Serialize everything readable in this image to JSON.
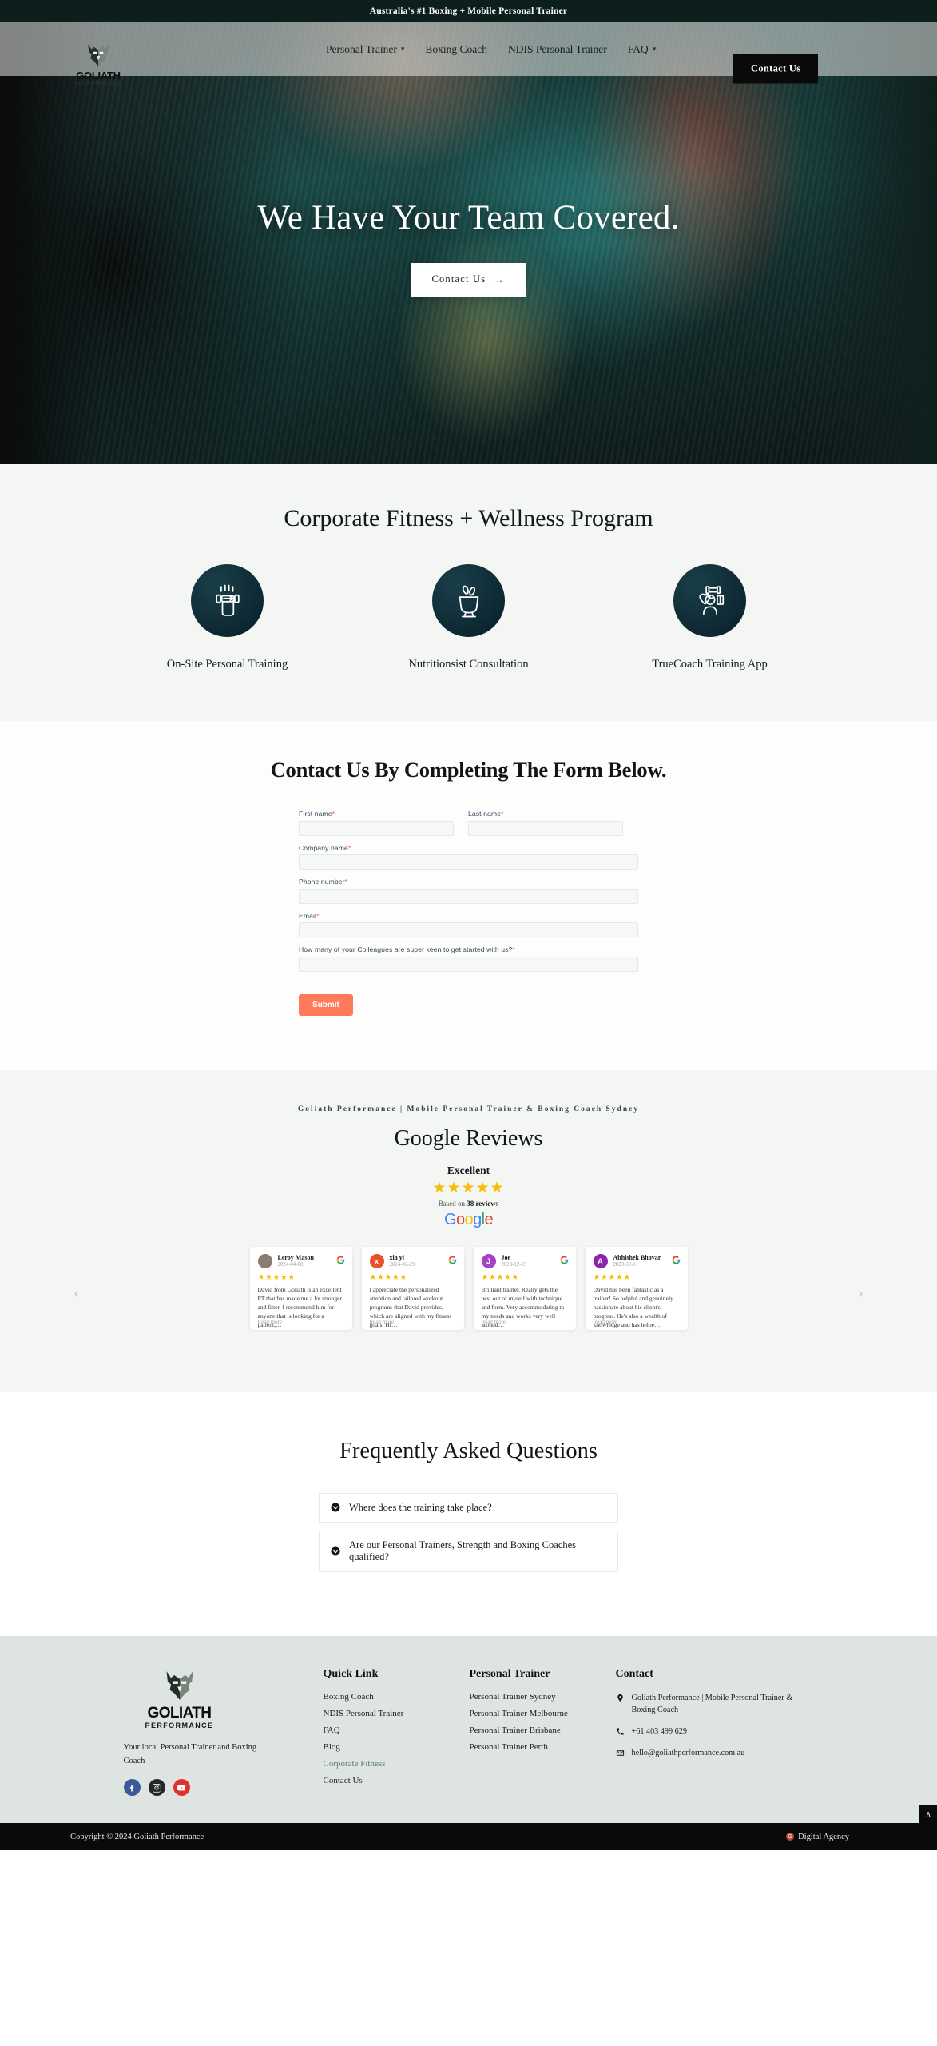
{
  "announcement": {
    "text": "Australia's #1 Boxing + Mobile Personal Trainer"
  },
  "brand": {
    "name": "GOLIATH",
    "sub": "PERFORMANCE"
  },
  "nav": {
    "items": [
      {
        "label": "Personal Trainer",
        "has_caret": true
      },
      {
        "label": "Boxing Coach",
        "has_caret": false
      },
      {
        "label": "NDIS Personal Trainer",
        "has_caret": false
      },
      {
        "label": "FAQ",
        "has_caret": true
      }
    ],
    "cta": "Contact Us"
  },
  "hero": {
    "title": "We Have Your Team Covered.",
    "cta": "Contact Us",
    "cta_arrow": "→"
  },
  "program": {
    "title": "Corporate Fitness + Wellness Program",
    "cards": [
      {
        "label": "On-Site Personal Training",
        "icon": "dumbbell-hand-icon"
      },
      {
        "label": "Nutritionsist Consultation",
        "icon": "nutrition-bowl-icon"
      },
      {
        "label": "TrueCoach Training App",
        "icon": "coach-app-icon"
      }
    ]
  },
  "form": {
    "title": "Contact Us By Completing The Form Below.",
    "fields": [
      {
        "label": "First name",
        "required": true,
        "value": "",
        "placeholder": "",
        "width": "half"
      },
      {
        "label": "Last name",
        "required": true,
        "value": "",
        "placeholder": "",
        "width": "half"
      },
      {
        "label": "Company name",
        "required": true,
        "value": "",
        "placeholder": "",
        "width": "full"
      },
      {
        "label": "Phone number",
        "required": true,
        "value": "",
        "placeholder": "",
        "width": "full"
      },
      {
        "label": "Email",
        "required": true,
        "value": "",
        "placeholder": "",
        "width": "full"
      },
      {
        "label": "How many of your Colleagues are super keen to get started with us?",
        "required": true,
        "value": "",
        "placeholder": "",
        "width": "full"
      }
    ],
    "submit": "Submit"
  },
  "reviews": {
    "eyebrow": "Goliath Performance | Mobile Personal Trainer & Boxing Coach Sydney",
    "title": "Google Reviews",
    "rating_word": "Excellent",
    "stars": "★★★★★",
    "based_prefix": "Based on ",
    "based_count": "38 reviews",
    "google_letters": [
      "G",
      "o",
      "o",
      "g",
      "l",
      "e"
    ],
    "read_more": "Read more",
    "items": [
      {
        "name": "Leroy Mason",
        "date": "2024-04-08",
        "initial": "L",
        "avatar_color": "#8a7c6e",
        "avatar_photo": true,
        "stars": "★★★★★",
        "text": "David from Goliath is an excellent PT that has made me a lot stronger and fitter. I recommend him for anyone that is looking for a patient,…"
      },
      {
        "name": "xia yi",
        "date": "2024-02-29",
        "initial": "x",
        "avatar_color": "#e8512a",
        "avatar_photo": false,
        "stars": "★★★★★",
        "text": "I appreciate the personalized attention and tailored workout programs that David provides, which are aligned with my fitness goals. Hi…"
      },
      {
        "name": "Joe",
        "date": "2023-12-15",
        "initial": "J",
        "avatar_color": "#a342c4",
        "avatar_photo": false,
        "stars": "★★★★★",
        "text": "Brilliant trainer. Really gets the best out of myself with technique and form. Very accommodating to my needs and works very well around…"
      },
      {
        "name": "Abhishek Bhovar",
        "date": "2023-12-11",
        "initial": "A",
        "avatar_color": "#8e24aa",
        "avatar_photo": false,
        "stars": "★★★★★",
        "text": "David has been fantastic as a trainer! So helpful and genuinely passionate about his client's progress. He's also a wealth of knowledge and has helpe…"
      }
    ],
    "prev_arrow": "‹",
    "next_arrow": "›"
  },
  "faq": {
    "title": "Frequently Asked Questions",
    "items": [
      {
        "question": "Where does the training take place?"
      },
      {
        "question": "Are our Personal Trainers, Strength and Boxing Coaches qualified?"
      }
    ]
  },
  "footer": {
    "tagline": "Your local Personal Trainer and Boxing Coach",
    "socials": [
      {
        "name": "facebook-icon"
      },
      {
        "name": "instagram-icon"
      },
      {
        "name": "youtube-icon"
      }
    ],
    "quick_link": {
      "heading": "Quick Link",
      "items": [
        {
          "label": "Boxing Coach",
          "active": false
        },
        {
          "label": "NDIS Personal Trainer",
          "active": false
        },
        {
          "label": "FAQ",
          "active": false
        },
        {
          "label": "Blog",
          "active": false
        },
        {
          "label": "Corporate Fitness",
          "active": true
        },
        {
          "label": "Contact Us",
          "active": false
        }
      ]
    },
    "personal_trainer": {
      "heading": "Personal Trainer",
      "items": [
        {
          "label": "Personal Trainer Sydney"
        },
        {
          "label": "Personal Trainer Melbourne"
        },
        {
          "label": "Personal Trainer Brisbane"
        },
        {
          "label": "Personal Trainer Perth"
        }
      ]
    },
    "contact": {
      "heading": "Contact",
      "address": "Goliath Performance | Mobile Personal Trainer & Boxing Coach",
      "phone": "+61 403 499 629",
      "email": "hello@goliathperformance.com.au"
    }
  },
  "copyright": {
    "left": "Copyright © 2024 Goliath Performance",
    "right": "Digital Agency",
    "mark": "G",
    "scroll_top": "∧"
  },
  "colors": {
    "announcement_bg": "#0d1f1c",
    "accent_orange": "#ff7a59",
    "footer_bg": "#dde4e2",
    "star_gold": "#fbbc05",
    "circle_dark": "#0c2630",
    "active_link": "#5f7d72"
  }
}
